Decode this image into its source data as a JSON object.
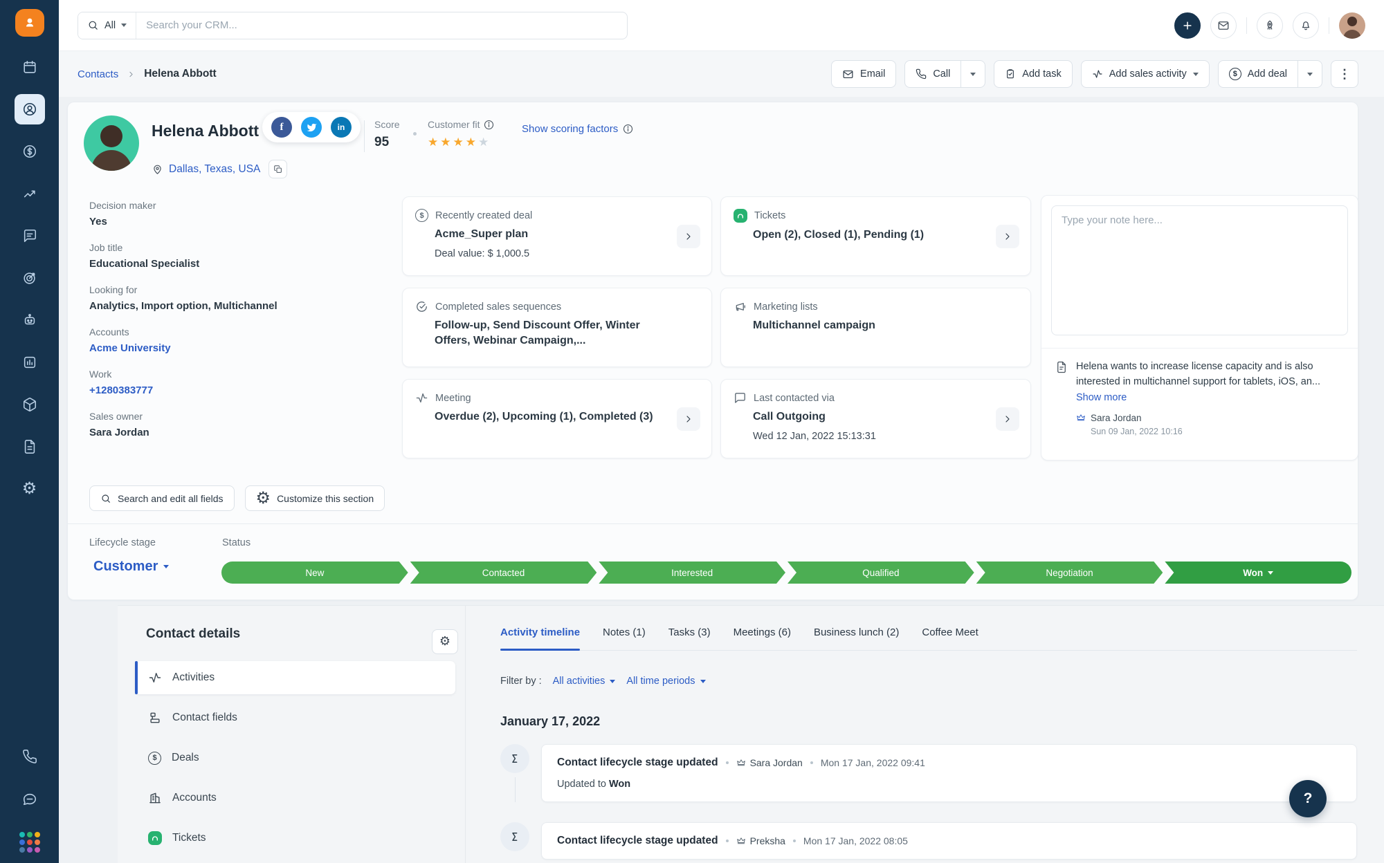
{
  "topbar": {
    "search_scope": "All",
    "search_placeholder": "Search your CRM..."
  },
  "breadcrumb": {
    "parent": "Contacts",
    "current": "Helena Abbott"
  },
  "actions": {
    "email": "Email",
    "call": "Call",
    "add_task": "Add task",
    "add_sales_activity": "Add sales activity",
    "add_deal": "Add deal"
  },
  "contact": {
    "name": "Helena Abbott",
    "location": "Dallas, Texas, USA",
    "score_label": "Score",
    "score_value": "95",
    "customer_fit_label": "Customer fit",
    "scoring_link": "Show scoring factors",
    "fields": [
      {
        "label": "Decision maker",
        "value": "Yes"
      },
      {
        "label": "Job title",
        "value": "Educational Specialist"
      },
      {
        "label": "Looking for",
        "value": "Analytics, Import option, Multichannel"
      },
      {
        "label": "Accounts",
        "value": "Acme University"
      },
      {
        "label": "Work",
        "value": "+1280383777"
      },
      {
        "label": "Sales owner",
        "value": "Sara Jordan"
      }
    ]
  },
  "summary_cards": [
    {
      "icon": "dollar-circle-icon",
      "title": "Recently created deal",
      "value": "Acme_Super plan",
      "extra": "Deal value: $ 1,000.5"
    },
    {
      "icon": "ticket-icon",
      "title": "Tickets",
      "value": "Open (2), Closed (1), Pending (1)"
    },
    {
      "icon": "sequence-check-icon",
      "title": "Completed sales sequences",
      "value": "Follow-up, Send Discount Offer, Winter Offers, Webinar Campaign,..."
    },
    {
      "icon": "megaphone-icon",
      "title": "Marketing lists",
      "value": "Multichannel campaign"
    },
    {
      "icon": "pulse-icon",
      "title": "Meeting",
      "value": "Overdue (2), Upcoming (1), Completed (3)"
    },
    {
      "icon": "message-icon",
      "title": "Last contacted via",
      "value": "Call Outgoing",
      "extra": "Wed 12 Jan, 2022 15:13:31"
    }
  ],
  "notes": {
    "placeholder": "Type your note here...",
    "text": "Helena wants to increase license capacity and is also interested in multichannel support for tablets, iOS, an...",
    "show_more": "Show more",
    "author": "Sara Jordan",
    "timestamp": "Sun 09 Jan, 2022 10:16"
  },
  "section_actions": {
    "search_fields": "Search and edit all fields",
    "customize": "Customize this section"
  },
  "lifecycle": {
    "label": "Lifecycle stage",
    "status_label": "Status",
    "stage_value": "Customer",
    "stages": [
      "New",
      "Contacted",
      "Interested",
      "Qualified",
      "Negotiation"
    ],
    "won": "Won"
  },
  "contact_details": {
    "title": "Contact details",
    "items": [
      {
        "icon": "pulse-icon",
        "label": "Activities"
      },
      {
        "icon": "fields-icon",
        "label": "Contact fields"
      },
      {
        "icon": "dollar-circle-icon",
        "label": "Deals"
      },
      {
        "icon": "building-icon",
        "label": "Accounts"
      },
      {
        "icon": "ticket-icon",
        "label": "Tickets"
      }
    ]
  },
  "timeline": {
    "tabs": [
      "Activity timeline",
      "Notes (1)",
      "Tasks (3)",
      "Meetings (6)",
      "Business lunch (2)",
      "Coffee Meet"
    ],
    "filter_label": "Filter by :",
    "filter_activities": "All activities",
    "filter_periods": "All time periods",
    "date_header": "January 17, 2022",
    "entries": [
      {
        "title": "Contact lifecycle stage updated",
        "author": "Sara Jordan",
        "time": "Mon 17 Jan, 2022 09:41",
        "body_prefix": "Updated to",
        "body_value": "Won"
      },
      {
        "title": "Contact lifecycle stage updated",
        "author": "Preksha",
        "time": "Mon 17 Jan, 2022 08:05"
      }
    ]
  },
  "sidebar": {
    "items": [
      "calendar",
      "contacts",
      "deals",
      "analytics",
      "conversations",
      "goals",
      "bot",
      "reports",
      "products",
      "documents",
      "settings"
    ],
    "bottom_items": [
      "phone",
      "chat",
      "apps"
    ]
  },
  "help": {
    "label": "?"
  },
  "colors": {
    "accent_blue": "#2c5cc5",
    "sidebar_navy": "#16334d",
    "logo_orange": "#f4821f",
    "stage_green": "#4cae53",
    "stage_won_green": "#319e43",
    "star_orange": "#f8a72d",
    "ticket_green": "#27b270",
    "facebook": "#3b5998",
    "twitter": "#1da1f2",
    "linkedin": "#0a78b5"
  }
}
